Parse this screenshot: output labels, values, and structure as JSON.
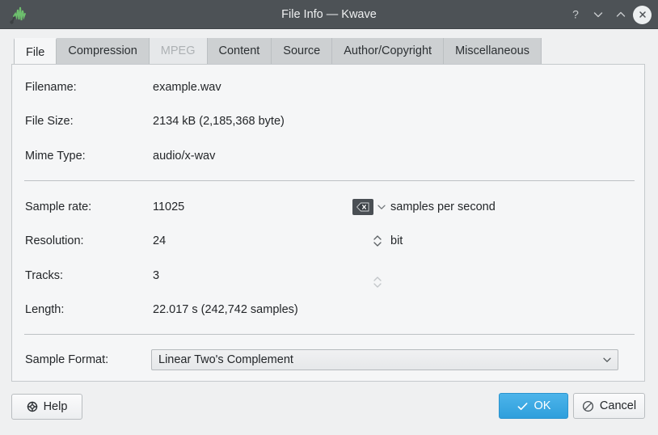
{
  "window": {
    "title": "File Info — Kwave",
    "app_icon": "kwave-waveform-icon",
    "controls": {
      "help": "?",
      "minimize": "chevron-down-icon",
      "maximize": "chevron-up-icon",
      "close": "close-icon"
    }
  },
  "tabs": [
    {
      "label": "File",
      "state": "active"
    },
    {
      "label": "Compression",
      "state": "normal"
    },
    {
      "label": "MPEG",
      "state": "disabled"
    },
    {
      "label": "Content",
      "state": "normal"
    },
    {
      "label": "Source",
      "state": "normal"
    },
    {
      "label": "Author/Copyright",
      "state": "normal"
    },
    {
      "label": "Miscellaneous",
      "state": "normal"
    }
  ],
  "file_tab": {
    "rows": [
      {
        "label": "Filename:",
        "value": "example.wav",
        "unit": ""
      },
      {
        "label": "File Size:",
        "value": "2134 kB (2,185,368 byte)",
        "unit": ""
      },
      {
        "label": "Mime Type:",
        "value": "audio/x-wav",
        "unit": ""
      },
      {
        "label": "Sample rate:",
        "value": "11025",
        "unit": "samples per second"
      },
      {
        "label": "Resolution:",
        "value": "24",
        "unit": "bit"
      },
      {
        "label": "Tracks:",
        "value": "3",
        "unit": ""
      },
      {
        "label": "Length:",
        "value": "22.017 s (242,742 samples)",
        "unit": ""
      }
    ],
    "sample_format": {
      "label": "Sample Format:",
      "value": "Linear Two's Complement",
      "arrow_icon": "chevron-down-icon"
    },
    "sample_rate_controls": {
      "clear_icon": "backspace-clear-icon",
      "dropdown_icon": "chevron-down-icon"
    },
    "resolution_spinner": {
      "icon": "spinner-up-down-icon",
      "state": "enabled"
    },
    "tracks_spinner": {
      "icon": "spinner-up-down-icon",
      "state": "disabled"
    }
  },
  "buttons": {
    "help": {
      "label": "Help",
      "icon": "help-lifebuoy-icon"
    },
    "ok": {
      "label": "OK",
      "icon": "check-icon"
    },
    "cancel": {
      "label": "Cancel",
      "icon": "no-entry-icon"
    }
  },
  "colors": {
    "titlebar": "#4d5256",
    "dialog_bg": "#eff0f1",
    "panel_bg": "#f5f6f7",
    "accent": "#3daee9",
    "tab_inactive": "#cdd0d2",
    "text": "#232629"
  }
}
